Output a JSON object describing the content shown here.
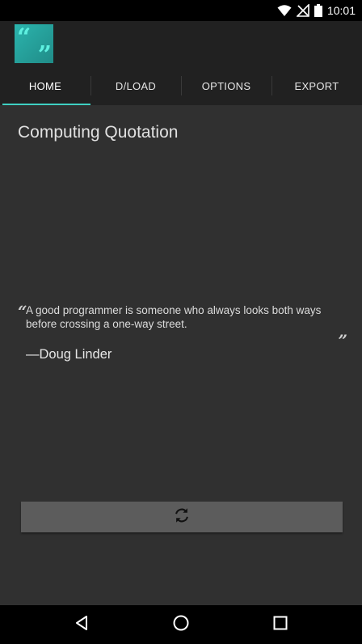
{
  "status_bar": {
    "time": "10:01",
    "icons": [
      "wifi-icon",
      "no-signal-icon",
      "battery-icon"
    ]
  },
  "app": {
    "logo_icon": "quote-logo-icon",
    "accent_color": "#3fd0c2"
  },
  "tabs": [
    {
      "label": "HOME",
      "active": true
    },
    {
      "label": "D/LOAD",
      "active": false
    },
    {
      "label": "OPTIONS",
      "active": false
    },
    {
      "label": "EXPORT",
      "active": false
    }
  ],
  "main": {
    "title": "Computing Quotation",
    "quote": {
      "text": "A good programmer is someone who always looks both ways before crossing a one-way street.",
      "author": "—Doug Linder"
    },
    "refresh_icon": "refresh-icon"
  },
  "nav_bar": {
    "icons": [
      "back-icon",
      "home-icon",
      "recents-icon"
    ]
  }
}
